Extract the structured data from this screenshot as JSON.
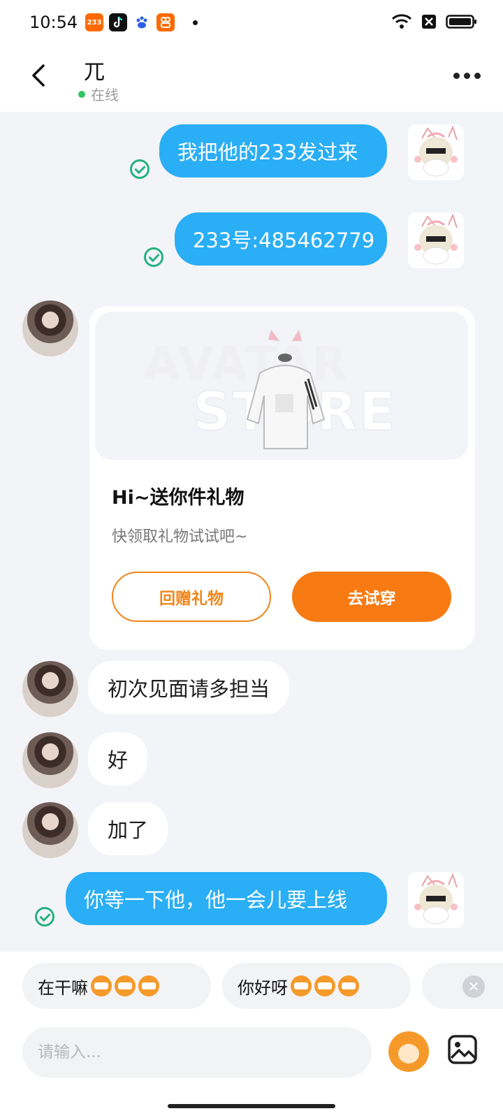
{
  "status_bar": {
    "time": "10:54",
    "apps": [
      "233",
      "tiktok",
      "baidu",
      "kuaishou"
    ]
  },
  "header": {
    "title": "兀",
    "status": "在线"
  },
  "messages": [
    {
      "side": "me",
      "text": "我把他的233发过来"
    },
    {
      "side": "me",
      "text": "233号:485462779"
    },
    {
      "side": "other",
      "type": "gift_card",
      "title": "Hi~送你件礼物",
      "subtitle": "快领取礼物试试吧~",
      "button_return": "回赠礼物",
      "button_try": "去试穿",
      "watermark_1": "AVATAR",
      "watermark_2": "STORE"
    },
    {
      "side": "other",
      "text": "初次见面请多担当"
    },
    {
      "side": "other",
      "text": "好"
    },
    {
      "side": "other",
      "text": "加了"
    },
    {
      "side": "me",
      "text": "你等一下他，他一会儿要上线"
    }
  ],
  "quick_replies": [
    {
      "label": "在干嘛"
    },
    {
      "label": "你好呀"
    }
  ],
  "input": {
    "placeholder": "请输入..."
  },
  "colors": {
    "my_bubble": "#2aaef5",
    "accent_orange": "#f77a12",
    "read_check": "#24b27e",
    "online": "#2ec55e"
  }
}
